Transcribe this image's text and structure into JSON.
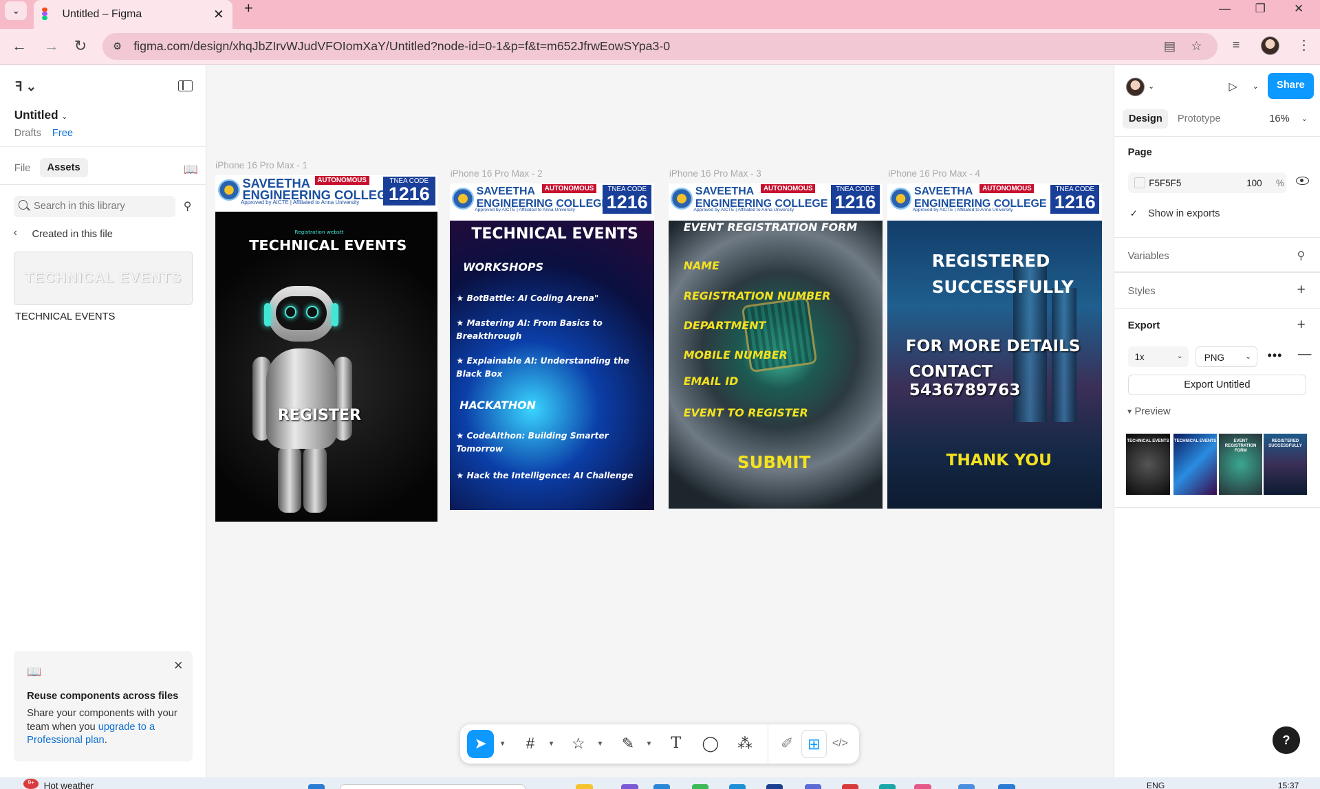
{
  "browser": {
    "tab_title": "Untitled – Figma",
    "url": "figma.com/design/xhqJbZIrvWJudVFOIomXaY/Untitled?node-id=0-1&p=f&t=m652JfrwEowSYpa3-0",
    "new_tab": "+",
    "close_tab": "✕",
    "back": "←",
    "forward": "→",
    "reload": "↻",
    "minimize": "—",
    "restore": "❐",
    "close": "✕"
  },
  "left_panel": {
    "file_name": "Untitled",
    "drafts": "Drafts",
    "plan": "Free",
    "tabs": [
      "File",
      "Assets"
    ],
    "search_placeholder": "Search in this library",
    "created_label": "Created in this file",
    "component_thumb_text": "TECHNICAL EVENTS",
    "component_name": "TECHNICAL EVENTS",
    "promo": {
      "title": "Reuse components across files",
      "body": "Share your components with your team when you ",
      "link": "upgrade to a Professional plan",
      "end": "."
    }
  },
  "canvas": {
    "frames": [
      {
        "label": "iPhone 16 Pro Max - 1",
        "header": {
          "college": "SAVEETHA",
          "college2": "ENGINEERING COLLEGE",
          "badge": "AUTONOMOUS",
          "sub": "Approved by AICTE | Affiliated to Anna University",
          "tnea": "TNEA CODE",
          "code": "1216"
        },
        "small_text": "Registration webstt",
        "title": "TECHNICAL EVENTS",
        "button": "REGISTER"
      },
      {
        "label": "iPhone 16 Pro Max - 2",
        "header": {
          "college": "SAVEETHA",
          "college2": "ENGINEERING COLLEGE",
          "badge": "AUTONOMOUS",
          "sub": "Approved by AICTE | Affiliated to Anna University",
          "tnea": "TNEA CODE",
          "code": "1216"
        },
        "title": "TECHNICAL EVENTS",
        "sections": [
          {
            "heading": "WORKSHOPS",
            "items": [
              "BotBattle: AI Coding Arena\"",
              "Mastering AI: From Basics to Breakthrough",
              "Explainable AI: Understanding the Black Box"
            ]
          },
          {
            "heading": "HACKATHON",
            "items": [
              "CodeAIthon: Building Smarter Tomorrow",
              "Hack the Intelligence: AI Challenge"
            ]
          }
        ]
      },
      {
        "label": "iPhone 16 Pro Max - 3",
        "header": {
          "college": "SAVEETHA",
          "college2": "ENGINEERING COLLEGE",
          "badge": "AUTONOMOUS",
          "sub": "Approved by AICTE | Affiliated to Anna University",
          "tnea": "TNEA CODE",
          "code": "1216"
        },
        "title": "EVENT REGISTRATION FORM",
        "fields": [
          "NAME",
          "REGISTRATION NUMBER",
          "DEPARTMENT",
          "MOBILE NUMBER",
          "EMAIL ID",
          "EVENT TO REGISTER"
        ],
        "button": "SUBMIT"
      },
      {
        "label": "iPhone 16 Pro Max - 4",
        "header": {
          "college": "SAVEETHA",
          "college2": "ENGINEERING COLLEGE",
          "badge": "AUTONOMOUS",
          "sub": "Approved by AICTE | Affiliated to Anna University",
          "tnea": "TNEA CODE",
          "code": "1216"
        },
        "line1": "REGISTERED",
        "line2": "SUCCESSFULLY",
        "line3": "FOR MORE DETAILS",
        "line4": "CONTACT 5436789763",
        "thanks": "THANK YOU"
      }
    ]
  },
  "right_panel": {
    "share": "Share",
    "tabs": [
      "Design",
      "Prototype"
    ],
    "zoom": "16%",
    "page_heading": "Page",
    "page_color": "F5F5F5",
    "page_opacity": "100",
    "page_opacity_unit": "%",
    "show_in_exports": "Show in exports",
    "variables": "Variables",
    "styles": "Styles",
    "export": "Export",
    "export_scale": "1x",
    "export_format": "PNG",
    "export_button": "Export Untitled",
    "preview": "Preview",
    "preview_thumbs": [
      "TECHNICAL EVENTS",
      "TECHNICAL EVENTS",
      "EVENT REGISTRATION FORM",
      "REGISTERED SUCCESSFULLY"
    ],
    "help": "?"
  },
  "taskbar": {
    "weather_badge": "9+",
    "weather": "Hot weather",
    "lang": "ENG",
    "time": "15:37"
  },
  "colors": {
    "accent": "#0d99ff",
    "chrome_pink": "#f7bac9",
    "page_bg": "#F5F5F5",
    "poster_yellow": "#f5e21f"
  }
}
